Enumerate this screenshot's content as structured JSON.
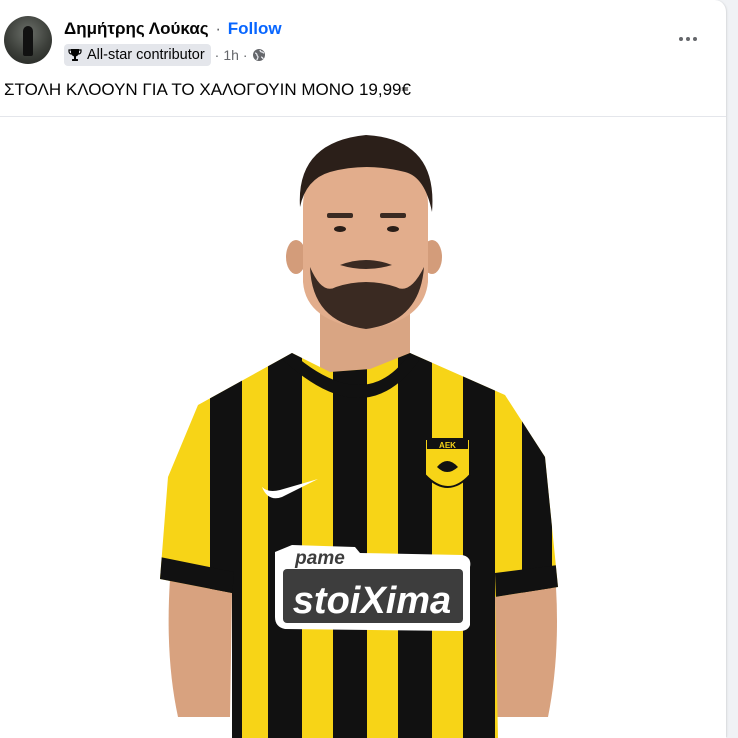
{
  "post": {
    "author": "Δημήτρης Λούκας",
    "separator": "·",
    "follow_label": "Follow",
    "badge_label": "All-star contributor",
    "time_prefix": "·",
    "time": "1h",
    "time_suffix": "·",
    "audience_icon": "globe-icon",
    "more_icon": "more-options-icon",
    "caption": "ΣΤΟΛΗ ΚΛΟΟΥΝ ΓΙΑ ΤΟ ΧΑΛΟΓΟΥΙΝ ΜΟΝΟ 19,99€"
  },
  "photo": {
    "sponsor_top": "pame",
    "sponsor_main": "stoiXima",
    "crest_text": "ΑΕΚ"
  },
  "colors": {
    "link": "#0866ff",
    "kit_yellow": "#f7d417",
    "kit_black": "#111111"
  }
}
